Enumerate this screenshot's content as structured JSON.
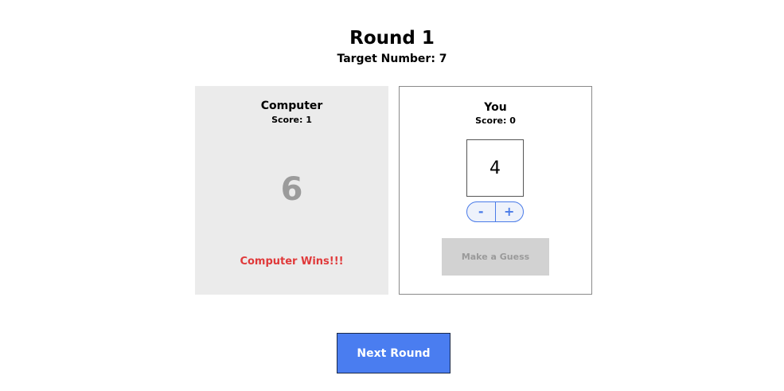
{
  "header": {
    "round_title": "Round 1",
    "target_text": "Target Number: 7"
  },
  "computer": {
    "name": "Computer",
    "score_text": "Score: 1",
    "guess": "6",
    "result": "Computer Wins!!!"
  },
  "player": {
    "name": "You",
    "score_text": "Score: 0",
    "guess": "4",
    "decrement_label": "-",
    "increment_label": "+",
    "make_guess_label": "Make a Guess"
  },
  "footer": {
    "next_round_label": "Next Round"
  },
  "colors": {
    "accent": "#4a7df0",
    "win_text": "#e0393a",
    "computer_panel_bg": "#ebebeb",
    "disabled_button_bg": "#d2d2d2"
  }
}
